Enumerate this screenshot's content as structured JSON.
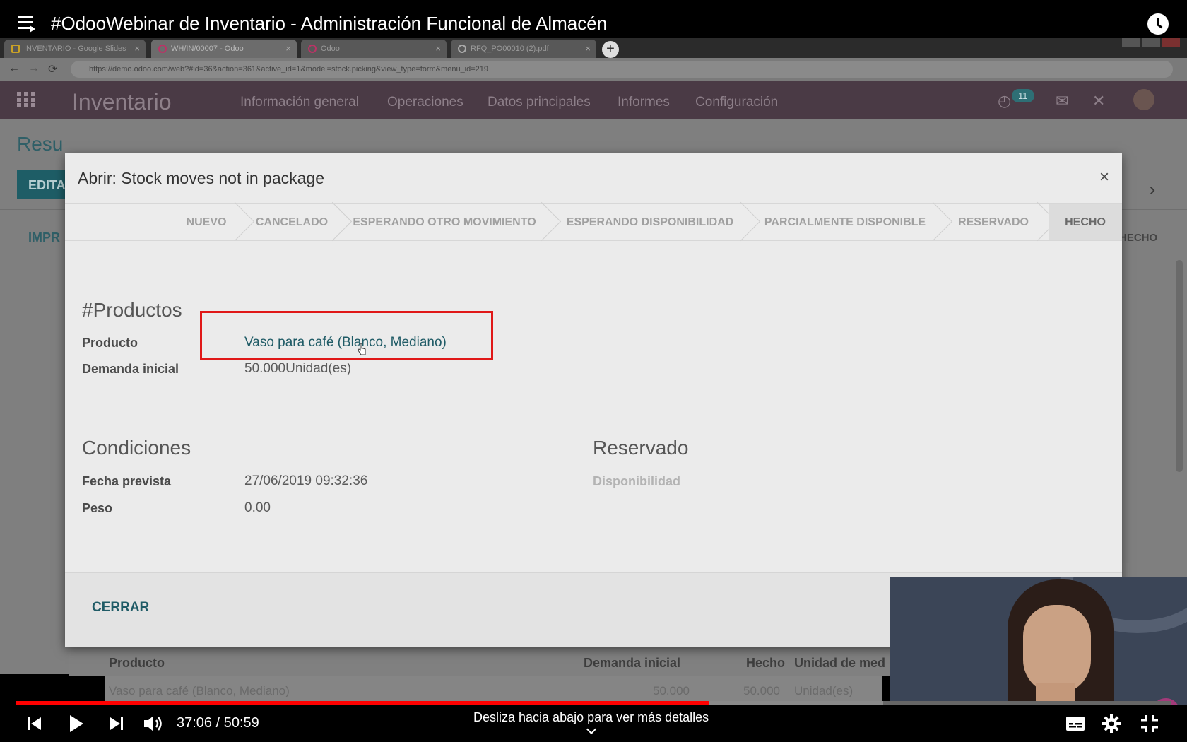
{
  "video": {
    "title": "#OdooWebinar de Inventario - Administración Funcional de Almacén",
    "current_time": "37:06",
    "duration": "50:59",
    "time_display": "37:06 / 50:59",
    "progress_fraction": 0.6,
    "scroll_hint": "Desliza hacia abajo para ver más detalles"
  },
  "browser": {
    "tabs": [
      {
        "label": "INVENTARIO - Google Slides"
      },
      {
        "label": "WH/IN/00007 - Odoo"
      },
      {
        "label": "Odoo"
      },
      {
        "label": "RFQ_PO00010 (2).pdf"
      }
    ],
    "url": "https://demo.odoo.com/web?#id=36&action=361&active_id=1&model=stock.picking&view_type=form&menu_id=219"
  },
  "odoo": {
    "app_name": "Inventario",
    "menu": [
      "Información general",
      "Operaciones",
      "Datos principales",
      "Informes",
      "Configuración"
    ],
    "activity_count": "11",
    "breadcrumb": "Resu",
    "edit_button": "EDITA",
    "print_button": "IMPR",
    "background_status": "HECHO",
    "background_table": {
      "headers": [
        "Producto",
        "Demanda inicial",
        "Hecho",
        "Unidad de med"
      ],
      "row": [
        "Vaso para café (Blanco, Mediano)",
        "50.000",
        "50.000",
        "Unidad(es)"
      ]
    }
  },
  "modal": {
    "title": "Abrir: Stock moves not in package",
    "close_glyph": "×",
    "stages": [
      "NUEVO",
      "CANCELADO",
      "ESPERANDO OTRO MOVIMIENTO",
      "ESPERANDO DISPONIBILIDAD",
      "PARCIALMENTE DISPONIBLE",
      "RESERVADO",
      "HECHO"
    ],
    "current_stage": "HECHO",
    "products_section": "#Productos",
    "product_label": "Producto",
    "product_value": "Vaso para café (Blanco, Mediano)",
    "demand_label": "Demanda inicial",
    "demand_value": "50.000Unidad(es)",
    "conditions_section": "Condiciones",
    "date_label": "Fecha prevista",
    "date_value": "27/06/2019 09:32:36",
    "weight_label": "Peso",
    "weight_value": "0.00",
    "reserved_section": "Reservado",
    "availability_label": "Disponibilidad",
    "close_button": "CERRAR"
  },
  "colors": {
    "odoo_nav": "#4a3a45",
    "odoo_teal": "#1f5b66",
    "highlight_red": "#e01818",
    "progress_red": "#ff0000"
  }
}
